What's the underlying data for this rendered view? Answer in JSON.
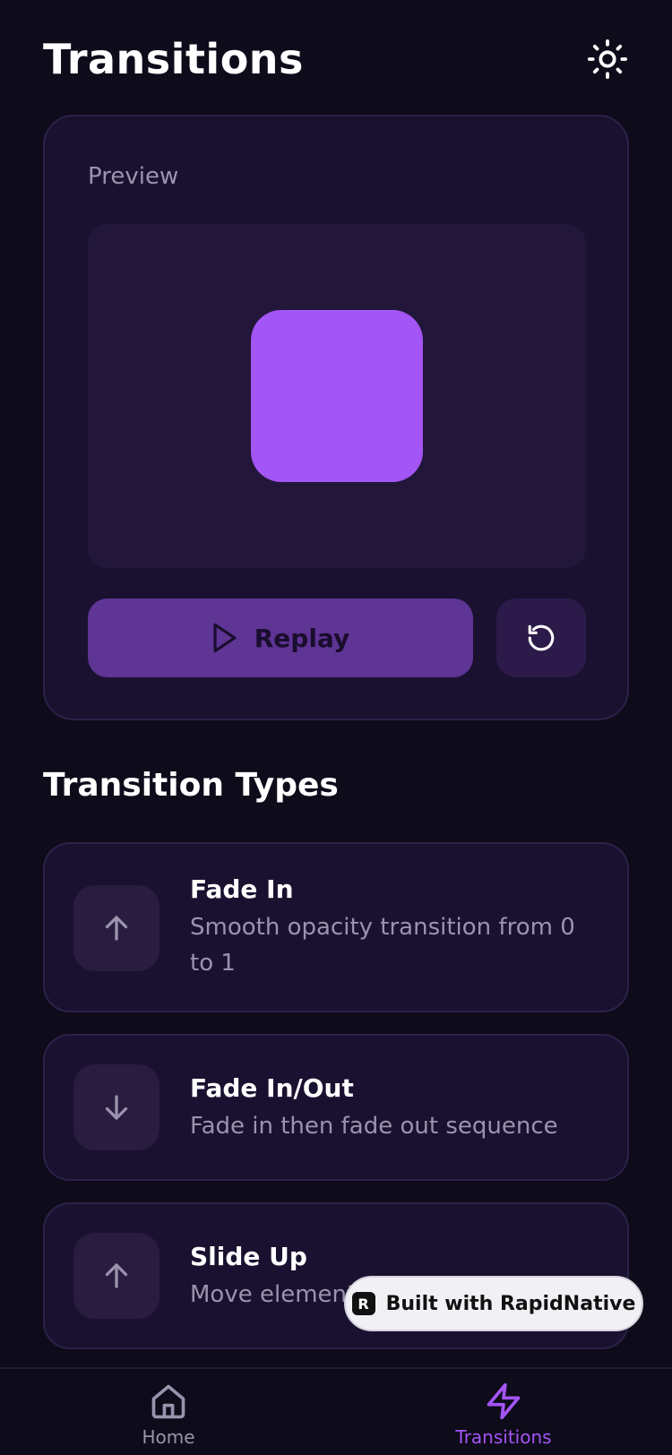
{
  "header": {
    "title": "Transitions",
    "theme_icon": "sun-icon"
  },
  "preview": {
    "label": "Preview",
    "box_color": "#a455f5",
    "replay_label": "Replay",
    "replay_icon": "play-icon",
    "reset_icon": "rotate-ccw-icon"
  },
  "transition_types": {
    "title": "Transition Types",
    "items": [
      {
        "title": "Fade In",
        "description": "Smooth opacity transition from 0 to 1",
        "icon": "arrow-up-icon"
      },
      {
        "title": "Fade In/Out",
        "description": "Fade in then fade out sequence",
        "icon": "arrow-down-icon"
      },
      {
        "title": "Slide Up",
        "description": "Move element up into view",
        "icon": "arrow-up-icon"
      }
    ]
  },
  "badge": {
    "label": "Built with RapidNative",
    "logo_letter": "R"
  },
  "tabbar": {
    "tabs": [
      {
        "label": "Home",
        "icon": "home-icon",
        "active": false
      },
      {
        "label": "Transitions",
        "icon": "zap-icon",
        "active": true
      }
    ]
  },
  "colors": {
    "accent": "#a455f5",
    "background": "#0e0b1a",
    "card": "#1a1130"
  }
}
